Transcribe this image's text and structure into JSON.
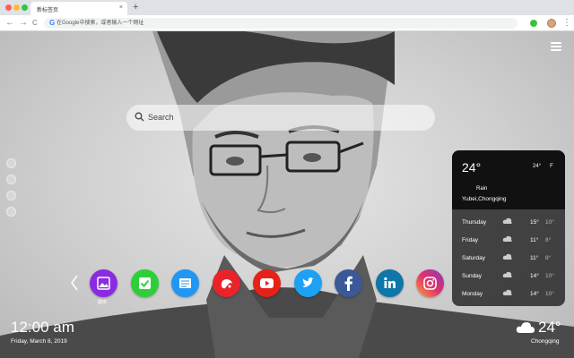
{
  "browser": {
    "tab_title": "新标签页",
    "tab_close": "×",
    "new_tab": "+",
    "back": "←",
    "forward": "→",
    "reload": "C",
    "search_engine_icon": "G",
    "omnibox_placeholder": "在Google中搜索，或者输入一个网址",
    "menu": "⋮",
    "colors": {
      "close": "#ff5f57",
      "minimize": "#febc2e",
      "maximize": "#28c840"
    }
  },
  "search": {
    "placeholder": "Search"
  },
  "weather": {
    "temp": "24°",
    "hi": "24°",
    "lo": "F",
    "condition": "Rain",
    "location": "Yubei,Chongqing",
    "forecast": [
      {
        "day": "Thursday",
        "hi": "15°",
        "lo": "10°"
      },
      {
        "day": "Friday",
        "hi": "11°",
        "lo": "8°"
      },
      {
        "day": "Saturday",
        "hi": "11°",
        "lo": "8°"
      },
      {
        "day": "Sunday",
        "hi": "14°",
        "lo": "10°"
      },
      {
        "day": "Monday",
        "hi": "14°",
        "lo": "10°"
      }
    ]
  },
  "apps": [
    {
      "icon": "gallery-icon",
      "label": "图库",
      "color": "#8a2be2"
    },
    {
      "icon": "check-icon",
      "color": "#2dcf38"
    },
    {
      "icon": "note-icon",
      "color": "#2196f3"
    },
    {
      "icon": "game-icon",
      "color": "#e8242a"
    },
    {
      "icon": "youtube-icon",
      "color": "#e62117"
    },
    {
      "icon": "twitter-icon",
      "color": "#1da1f2"
    },
    {
      "icon": "facebook-icon",
      "color": "#3b5998"
    },
    {
      "icon": "linkedin-icon",
      "color": "#0e76a8"
    },
    {
      "icon": "instagram-icon",
      "color": "#d6249f"
    }
  ],
  "clock": {
    "time": "12:00 am",
    "date": "Friday, March 8, 2019"
  },
  "bottom_weather": {
    "temp": "24°",
    "city": "Chongqing"
  }
}
